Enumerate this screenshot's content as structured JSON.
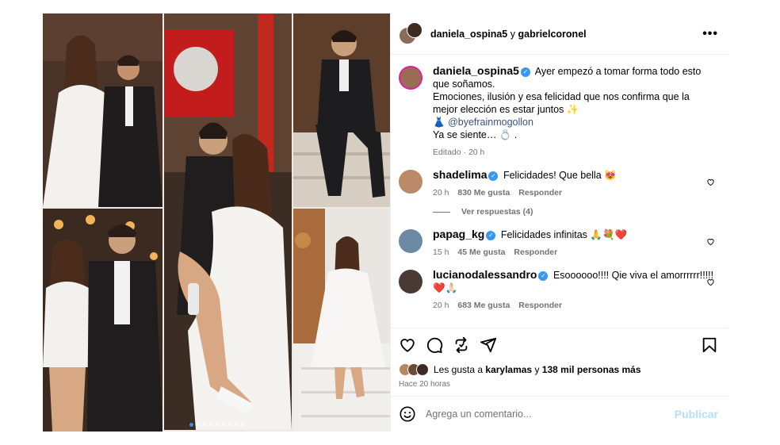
{
  "header": {
    "user1": "daniela_ospina5",
    "connector": "y",
    "user2": "gabrielcoronel",
    "more_label": "•••"
  },
  "caption": {
    "username": "daniela_ospina5",
    "line1": "Ayer empezó a tomar forma todo esto que soñamos.",
    "line2": "Emociones, ilusión y esa felicidad que nos confirma que la mejor elección es estar juntos ✨",
    "line3_icon": "👗",
    "line3_mention": "@byefrainmogollon",
    "line4": "Ya se siente… 💍 .",
    "meta": "Editado · 20 h"
  },
  "comments": [
    {
      "username": "shadelima",
      "text": "Felicidades! Que bella 😻",
      "time": "20 h",
      "likes": "830 Me gusta",
      "reply": "Responder"
    },
    {
      "username": "papag_kg",
      "text": "Felicidades infinitas 🙏💐❤️",
      "time": "15 h",
      "likes": "45 Me gusta",
      "reply": "Responder"
    },
    {
      "username": "lucianodalessandro",
      "text": "Esoooooo!!!! Qie viva el amorrrrrr!!!!! ❤️🙏🏻",
      "time": "20 h",
      "likes": "683 Me gusta",
      "reply": "Responder"
    }
  ],
  "view_replies": "Ver respuestas (4)",
  "likes": {
    "prefix": "Les gusta a",
    "user": "karylamas",
    "connector": "y",
    "count": "138 mil personas más"
  },
  "posted": "Hace 20 horas",
  "add_comment": {
    "placeholder": "Agrega un comentario...",
    "publish": "Publicar"
  },
  "carousel": {
    "count": 9,
    "active": 0
  },
  "colors": {
    "verified": "#3897f0",
    "link": "#385185",
    "publish_disabled": "#b2dffc",
    "muted": "#737373"
  },
  "icons": [
    "heart-icon",
    "comment-icon",
    "repost-icon",
    "share-icon",
    "bookmark-icon",
    "emoji-icon",
    "more-icon",
    "verified-icon"
  ]
}
